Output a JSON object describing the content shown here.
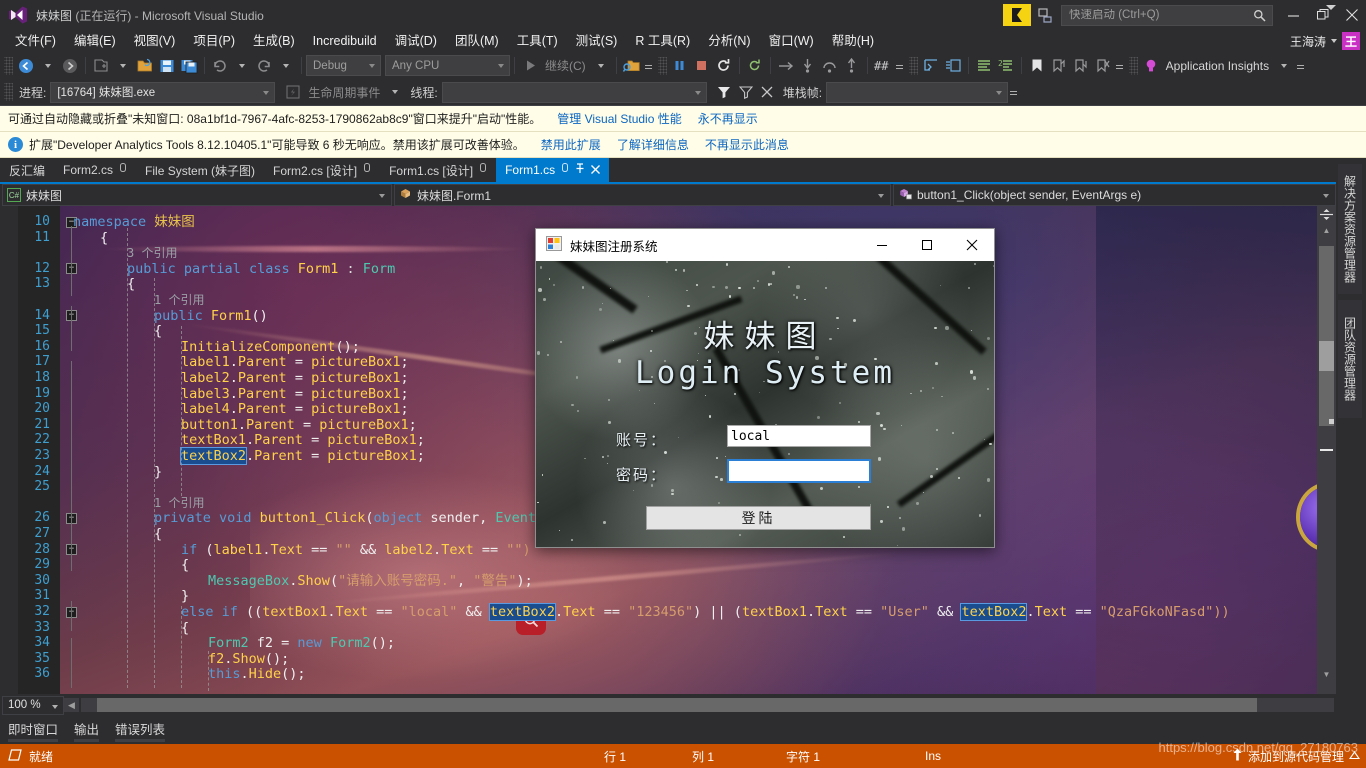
{
  "titlebar": {
    "project": "妹妹图",
    "running_suffix": "(正在运行) - Microsoft Visual Studio",
    "logo_icon": "visual-studio-logo-icon",
    "feedback_icon": "feedback-flag-icon",
    "feedback2_icon": "screenshot-feedback-icon",
    "search_icon": "magnifier-icon",
    "quick_launch_placeholder": "快速启动 (Ctrl+Q)",
    "quick_launch_value": "",
    "minimize": "—",
    "restore": "❐",
    "close": "✕"
  },
  "menu": {
    "items": [
      {
        "label": "文件(F)"
      },
      {
        "label": "编辑(E)"
      },
      {
        "label": "视图(V)"
      },
      {
        "label": "项目(P)"
      },
      {
        "label": "生成(B)"
      },
      {
        "label": "Incredibuild"
      },
      {
        "label": "调试(D)"
      },
      {
        "label": "团队(M)"
      },
      {
        "label": "工具(T)"
      },
      {
        "label": "测试(S)"
      },
      {
        "label": "R 工具(R)"
      },
      {
        "label": "分析(N)"
      },
      {
        "label": "窗口(W)"
      },
      {
        "label": "帮助(H)"
      }
    ],
    "user_name": "王海涛",
    "avatar_initial": "王"
  },
  "toolbar": {
    "nav_back_icon": "navigate-back-icon",
    "nav_forward_icon": "navigate-forward-icon",
    "new_project_icon": "new-project-icon",
    "open_file_icon": "open-file-icon",
    "save_icon": "save-icon",
    "save_all_icon": "save-all-icon",
    "undo_icon": "undo-icon",
    "redo_icon": "redo-icon",
    "config_value": "Debug",
    "platform_value": "Any CPU",
    "continue_label": "继续(C)",
    "play_icon": "start-debug-icon",
    "attach_icon": "attach-to-process-icon",
    "pause_icon": "pause-icon",
    "stop_icon": "stop-icon",
    "restart_icon": "restart-icon",
    "hot_reload_icon": "hot-reload-icon",
    "step_into_icon": "step-into-icon",
    "step_over_icon": "step-over-icon",
    "step_out_icon": "step-out-icon",
    "show_next_icon": "show-next-statement-icon",
    "il_icon": "intermediate-language-icon",
    "indent_icon": "indent-icon",
    "outdent_icon": "outdent-icon",
    "comment_icon": "comment-icon",
    "uncomment_icon": "uncomment-icon",
    "bookmark_icon": "bookmark-icon",
    "prev_bookmark_icon": "previous-bookmark-icon",
    "next_bookmark_icon": "next-bookmark-icon",
    "clear_bookmark_icon": "clear-bookmarks-icon",
    "app_insights_label": "Application Insights",
    "app_insights_icon": "lightbulb-icon"
  },
  "debug_toolbar": {
    "process_label": "进程:",
    "process_value": "[16764] 妹妹图.exe",
    "lifecycle_label": "生命周期事件",
    "lifecycle_icon": "lifecycle-events-icon",
    "thread_label": "线程:",
    "thread_value": "",
    "filter_icon": "filter-icon",
    "unfilter_icon": "clear-filter-icon",
    "noflag_icon": "no-flag-icon",
    "stackframe_label": "堆栈帧:"
  },
  "infobars": [
    {
      "icon": "none",
      "text": "可通过自动隐藏或折叠\"未知窗口: 08a1bf1d-7967-4afc-8253-1790862ab8c9\"窗口来提升\"启动\"性能。",
      "links": [
        "管理 Visual Studio 性能",
        "永不再显示"
      ]
    },
    {
      "icon": "info-icon",
      "text": "扩展\"Developer Analytics Tools 8.12.10405.1\"可能导致 6 秒无响应。禁用该扩展可改善体验。",
      "links": [
        "禁用此扩展",
        "了解详细信息",
        "不再显示此消息"
      ]
    }
  ],
  "doc_tabs": [
    {
      "label": "反汇编",
      "active": false,
      "pinned": false,
      "closable": false
    },
    {
      "label": "Form2.cs",
      "active": false,
      "pinned": true,
      "closable": false
    },
    {
      "label": "File System (妹子图)",
      "active": false,
      "pinned": false,
      "closable": false
    },
    {
      "label": "Form2.cs [设计]",
      "active": false,
      "pinned": true,
      "closable": false
    },
    {
      "label": "Form1.cs [设计]",
      "active": false,
      "pinned": true,
      "closable": false
    },
    {
      "label": "Form1.cs",
      "active": true,
      "pinned": true,
      "closable": true
    }
  ],
  "navbar": {
    "project_badge": "C#",
    "project_value": "妹妹图",
    "type_value": "妹妹图.Form1",
    "type_icon": "class-icon",
    "member_value": "button1_Click(object sender, EventArgs e)",
    "member_icon": "method-icon"
  },
  "editor": {
    "zoom": "100 %",
    "lines": [
      {
        "num": "10",
        "indent": 0,
        "fold": "minus",
        "tokens": [
          {
            "t": "namespace ",
            "c": "k"
          },
          {
            "t": "妹妹图",
            "c": "ns"
          }
        ]
      },
      {
        "num": "11",
        "indent": 1,
        "fold": "",
        "tokens": [
          {
            "t": "{",
            "c": "wht"
          }
        ]
      },
      {
        "num": "",
        "indent": 2,
        "fold": "",
        "tokens": [
          {
            "t": "3 个引用",
            "c": "ref"
          }
        ]
      },
      {
        "num": "12",
        "indent": 2,
        "fold": "minus",
        "tokens": [
          {
            "t": "public ",
            "c": "k"
          },
          {
            "t": "partial ",
            "c": "k"
          },
          {
            "t": "class ",
            "c": "k"
          },
          {
            "t": "Form1",
            "c": "id"
          },
          {
            "t": " : ",
            "c": "op"
          },
          {
            "t": "Form",
            "c": "cls"
          }
        ]
      },
      {
        "num": "13",
        "indent": 2,
        "fold": "",
        "tokens": [
          {
            "t": "{",
            "c": "wht"
          }
        ]
      },
      {
        "num": "",
        "indent": 3,
        "fold": "",
        "tokens": [
          {
            "t": "1 个引用",
            "c": "ref"
          }
        ]
      },
      {
        "num": "14",
        "indent": 3,
        "fold": "minus",
        "tokens": [
          {
            "t": "public ",
            "c": "k"
          },
          {
            "t": "Form1",
            "c": "id"
          },
          {
            "t": "()",
            "c": "wht"
          }
        ]
      },
      {
        "num": "15",
        "indent": 3,
        "fold": "",
        "tokens": [
          {
            "t": "{",
            "c": "wht"
          }
        ]
      },
      {
        "num": "16",
        "indent": 4,
        "fold": "",
        "tokens": [
          {
            "t": "InitializeComponent",
            "c": "id"
          },
          {
            "t": "();",
            "c": "wht"
          }
        ]
      },
      {
        "num": "17",
        "indent": 4,
        "fold": "",
        "tokens": [
          {
            "t": "label1",
            "c": "id"
          },
          {
            "t": ".",
            "c": "wht"
          },
          {
            "t": "Parent",
            "c": "id"
          },
          {
            "t": " = ",
            "c": "wht"
          },
          {
            "t": "pictureBox1",
            "c": "id"
          },
          {
            "t": ";",
            "c": "wht"
          }
        ]
      },
      {
        "num": "18",
        "indent": 4,
        "fold": "",
        "tokens": [
          {
            "t": "label2",
            "c": "id"
          },
          {
            "t": ".",
            "c": "wht"
          },
          {
            "t": "Parent",
            "c": "id"
          },
          {
            "t": " = ",
            "c": "wht"
          },
          {
            "t": "pictureBox1",
            "c": "id"
          },
          {
            "t": ";",
            "c": "wht"
          }
        ]
      },
      {
        "num": "19",
        "indent": 4,
        "fold": "",
        "tokens": [
          {
            "t": "label3",
            "c": "id"
          },
          {
            "t": ".",
            "c": "wht"
          },
          {
            "t": "Parent",
            "c": "id"
          },
          {
            "t": " = ",
            "c": "wht"
          },
          {
            "t": "pictureBox1",
            "c": "id"
          },
          {
            "t": ";",
            "c": "wht"
          }
        ]
      },
      {
        "num": "20",
        "indent": 4,
        "fold": "",
        "tokens": [
          {
            "t": "label4",
            "c": "id"
          },
          {
            "t": ".",
            "c": "wht"
          },
          {
            "t": "Parent",
            "c": "id"
          },
          {
            "t": " = ",
            "c": "wht"
          },
          {
            "t": "pictureBox1",
            "c": "id"
          },
          {
            "t": ";",
            "c": "wht"
          }
        ]
      },
      {
        "num": "21",
        "indent": 4,
        "fold": "",
        "tokens": [
          {
            "t": "button1",
            "c": "id"
          },
          {
            "t": ".",
            "c": "wht"
          },
          {
            "t": "Parent",
            "c": "id"
          },
          {
            "t": " = ",
            "c": "wht"
          },
          {
            "t": "pictureBox1",
            "c": "id"
          },
          {
            "t": ";",
            "c": "wht"
          }
        ]
      },
      {
        "num": "22",
        "indent": 4,
        "fold": "",
        "tokens": [
          {
            "t": "textBox1",
            "c": "id"
          },
          {
            "t": ".",
            "c": "wht"
          },
          {
            "t": "Parent",
            "c": "id"
          },
          {
            "t": " = ",
            "c": "wht"
          },
          {
            "t": "pictureBox1",
            "c": "id"
          },
          {
            "t": ";",
            "c": "wht"
          }
        ]
      },
      {
        "num": "23",
        "indent": 4,
        "fold": "",
        "tokens": [
          {
            "t": "textBox2",
            "c": "sel"
          },
          {
            "t": ".",
            "c": "wht"
          },
          {
            "t": "Parent",
            "c": "id"
          },
          {
            "t": " = ",
            "c": "wht"
          },
          {
            "t": "pictureBox1",
            "c": "id"
          },
          {
            "t": ";",
            "c": "wht"
          }
        ]
      },
      {
        "num": "24",
        "indent": 3,
        "fold": "",
        "tokens": [
          {
            "t": "}",
            "c": "wht"
          }
        ]
      },
      {
        "num": "25",
        "indent": 3,
        "fold": "",
        "tokens": []
      },
      {
        "num": "",
        "indent": 3,
        "fold": "",
        "tokens": [
          {
            "t": "1 个引用",
            "c": "ref"
          }
        ]
      },
      {
        "num": "26",
        "indent": 3,
        "fold": "minus",
        "tokens": [
          {
            "t": "private ",
            "c": "k"
          },
          {
            "t": "void ",
            "c": "k"
          },
          {
            "t": "button1_Click",
            "c": "id"
          },
          {
            "t": "(",
            "c": "wht"
          },
          {
            "t": "object",
            "c": "k"
          },
          {
            "t": " sender, ",
            "c": "wht"
          },
          {
            "t": "EventArgs",
            "c": "cls"
          },
          {
            "t": " e)",
            "c": "wht"
          }
        ]
      },
      {
        "num": "27",
        "indent": 3,
        "fold": "",
        "tokens": [
          {
            "t": "{",
            "c": "wht"
          }
        ]
      },
      {
        "num": "28",
        "indent": 4,
        "fold": "minus",
        "tokens": [
          {
            "t": "if",
            "c": "k"
          },
          {
            "t": " (",
            "c": "wht"
          },
          {
            "t": "label1",
            "c": "id"
          },
          {
            "t": ".",
            "c": "wht"
          },
          {
            "t": "Text",
            "c": "id"
          },
          {
            "t": " == ",
            "c": "wht"
          },
          {
            "t": "\"\"",
            "c": "str"
          },
          {
            "t": " && ",
            "c": "wht"
          },
          {
            "t": "label2",
            "c": "id"
          },
          {
            "t": ".",
            "c": "wht"
          },
          {
            "t": "Text",
            "c": "id"
          },
          {
            "t": " == ",
            "c": "wht"
          },
          {
            "t": "\"\")",
            "c": "str"
          }
        ]
      },
      {
        "num": "29",
        "indent": 4,
        "fold": "",
        "tokens": [
          {
            "t": "{",
            "c": "wht"
          }
        ]
      },
      {
        "num": "30",
        "indent": 5,
        "fold": "",
        "tokens": [
          {
            "t": "MessageBox",
            "c": "cls"
          },
          {
            "t": ".",
            "c": "wht"
          },
          {
            "t": "Show",
            "c": "id"
          },
          {
            "t": "(",
            "c": "wht"
          },
          {
            "t": "\"请输入账号密码.\"",
            "c": "str"
          },
          {
            "t": ", ",
            "c": "wht"
          },
          {
            "t": "\"警告\"",
            "c": "str"
          },
          {
            "t": ");",
            "c": "wht"
          }
        ]
      },
      {
        "num": "31",
        "indent": 4,
        "fold": "",
        "tokens": [
          {
            "t": "}",
            "c": "wht"
          }
        ]
      },
      {
        "num": "32",
        "indent": 4,
        "fold": "minus",
        "tokens": [
          {
            "t": "else ",
            "c": "k"
          },
          {
            "t": "if",
            "c": "k"
          },
          {
            "t": " ((",
            "c": "wht"
          },
          {
            "t": "textBox1",
            "c": "id"
          },
          {
            "t": ".",
            "c": "wht"
          },
          {
            "t": "Text",
            "c": "id"
          },
          {
            "t": " == ",
            "c": "wht"
          },
          {
            "t": "\"local\"",
            "c": "str"
          },
          {
            "t": " && ",
            "c": "wht"
          },
          {
            "t": "textBox2",
            "c": "sel"
          },
          {
            "t": ".",
            "c": "wht"
          },
          {
            "t": "Text",
            "c": "id"
          },
          {
            "t": " == ",
            "c": "wht"
          },
          {
            "t": "\"123456\"",
            "c": "str"
          },
          {
            "t": ") || (",
            "c": "wht"
          },
          {
            "t": "textBox1",
            "c": "id"
          },
          {
            "t": ".",
            "c": "wht"
          },
          {
            "t": "Text",
            "c": "id"
          },
          {
            "t": " == ",
            "c": "wht"
          },
          {
            "t": "\"User\"",
            "c": "str"
          },
          {
            "t": " && ",
            "c": "wht"
          },
          {
            "t": "textBox2",
            "c": "sel"
          },
          {
            "t": ".",
            "c": "wht"
          },
          {
            "t": "Text",
            "c": "id"
          },
          {
            "t": " == ",
            "c": "wht"
          },
          {
            "t": "\"QzaFGkoNFasd\"))",
            "c": "str"
          }
        ]
      },
      {
        "num": "33",
        "indent": 4,
        "fold": "",
        "tokens": [
          {
            "t": "{",
            "c": "wht"
          }
        ]
      },
      {
        "num": "34",
        "indent": 5,
        "fold": "",
        "tokens": [
          {
            "t": "Form2",
            "c": "cls"
          },
          {
            "t": " f2 = ",
            "c": "wht"
          },
          {
            "t": "new ",
            "c": "k"
          },
          {
            "t": "Form2",
            "c": "cls"
          },
          {
            "t": "();",
            "c": "wht"
          }
        ]
      },
      {
        "num": "35",
        "indent": 5,
        "fold": "",
        "tokens": [
          {
            "t": "f2",
            "c": "id"
          },
          {
            "t": ".",
            "c": "wht"
          },
          {
            "t": "Show",
            "c": "id"
          },
          {
            "t": "();",
            "c": "wht"
          }
        ]
      },
      {
        "num": "36",
        "indent": 5,
        "fold": "",
        "tokens": [
          {
            "t": "this",
            "c": "k"
          },
          {
            "t": ".",
            "c": "wht"
          },
          {
            "t": "Hide",
            "c": "id"
          },
          {
            "t": "();",
            "c": "wht"
          }
        ]
      }
    ]
  },
  "right_dock": {
    "tabs": [
      "解决方案资源管理器",
      "团队资源管理器"
    ]
  },
  "bottom_tabs": [
    {
      "label": "即时窗口"
    },
    {
      "label": "输出"
    },
    {
      "label": "错误列表"
    }
  ],
  "status": {
    "ready": "就绪",
    "ready_icon": "ready-icon",
    "line": "行 1",
    "column": "列 1",
    "char": "字符 1",
    "insert": "Ins",
    "source_control": "添加到源代码管理",
    "source_control_icon": "upload-icon",
    "expand_icon": "expand-up-icon",
    "accent": "#ca5100"
  },
  "watermark": "https://blog.csdn.net/qq_27180763",
  "dialog": {
    "title": "妹妹图注册系统",
    "app_icon": "windows-form-icon",
    "minimize": "—",
    "maximize": "☐",
    "close": "✕",
    "heading_cn": "妹妹图",
    "heading_en": "Login System",
    "account_label": "账号：",
    "account_value": "local",
    "password_label": "密码：",
    "password_value": "",
    "login_button": "登陆"
  }
}
